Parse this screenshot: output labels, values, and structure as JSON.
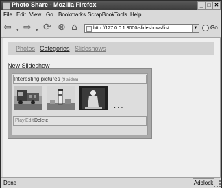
{
  "window": {
    "title": "Photo Share - Mozilla Firefox"
  },
  "menu": [
    "File",
    "Edit",
    "View",
    "Go",
    "Bookmarks",
    "ScrapBook",
    "Tools",
    "Help"
  ],
  "toolbar": {
    "url": "http://127.0.0.1:3000/slideshows/list",
    "go_label": "Go"
  },
  "nav": {
    "links": [
      "Photos",
      "Categories",
      "Slideshows"
    ],
    "active_index": 1
  },
  "page": {
    "heading": "New Slideshow",
    "slideshow": {
      "title": "Interesting pictures",
      "count": "(9 slides)",
      "ellipsis": "...",
      "actions": [
        "Play",
        "Edit",
        "Delete"
      ]
    }
  },
  "status": {
    "text": "Done",
    "adblock": "Adblock"
  },
  "colors": {
    "window_border": "#2e2e2e",
    "titlebar": "#3b3b3b",
    "content_bg": "#efefef",
    "nav_strip": "#d2d2d2",
    "link_inactive": "#7c7c7c"
  }
}
